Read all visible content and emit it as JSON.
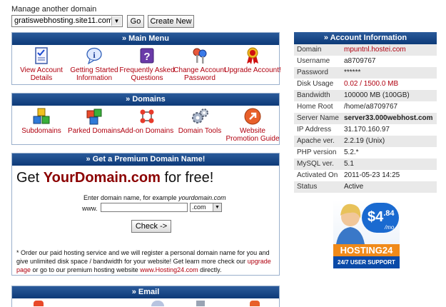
{
  "manage": {
    "label": "Manage another domain",
    "selected_domain": "gratiswebhosting.site11.com",
    "go_label": "Go",
    "create_label": "Create New"
  },
  "main_menu": {
    "title": "» Main Menu",
    "items": [
      {
        "label": "View Account Details",
        "icon": "checklist-icon"
      },
      {
        "label": "Getting Started Information",
        "icon": "info-bubble-icon"
      },
      {
        "label": "Frequently Asked Questions",
        "icon": "question-box-icon"
      },
      {
        "label": "Change Account Password",
        "icon": "keys-icon"
      },
      {
        "label": "Upgrade Account!",
        "icon": "award-ribbon-icon"
      }
    ]
  },
  "domains": {
    "title": "» Domains",
    "items": [
      {
        "label": "Subdomains",
        "icon": "cubes-icon"
      },
      {
        "label": "Parked Domains",
        "icon": "parked-cubes-icon"
      },
      {
        "label": "Add-on Domains",
        "icon": "molecule-icon"
      },
      {
        "label": "Domain Tools",
        "icon": "gears-icon"
      },
      {
        "label": "Website Promotion Guide",
        "icon": "arrow-circle-icon"
      }
    ]
  },
  "premium": {
    "title": "» Get a Premium Domain Name!",
    "headline_pre": "Get ",
    "headline_domain": "YourDomain.com",
    "headline_post": " for free!",
    "instruction": "Enter domain name, for example",
    "instruction_example": "yourdomain.com",
    "www": "www.",
    "tld": ".com",
    "check_label": "Check ->",
    "note_1": "* Order our paid hosting service and we will register a personal domain name for you and give unlimited disk space / bandwidth for your website! Get learn more check our",
    "note_link_1": "upgrade page",
    "note_2": " or go to our premium hosting website ",
    "note_link_2": "www.Hosting24.com",
    "note_3": " directly."
  },
  "email": {
    "title": "» Email"
  },
  "account": {
    "title": "» Account Information",
    "rows": [
      {
        "k": "Domain",
        "v": "mpuntnl.hostei.com"
      },
      {
        "k": "Username",
        "v": "a8709767"
      },
      {
        "k": "Password",
        "v": "******"
      },
      {
        "k": "Disk Usage",
        "v": "0.02 / 1500.0 MB"
      },
      {
        "k": "Bandwidth",
        "v": "100000 MB (100GB)"
      },
      {
        "k": "Home Root",
        "v": "/home/a8709767"
      },
      {
        "k": "Server Name",
        "v": "server33.000webhost.com"
      },
      {
        "k": "IP Address",
        "v": "31.170.160.97"
      },
      {
        "k": "Apache ver.",
        "v": "2.2.19 (Unix)"
      },
      {
        "k": "PHP version",
        "v": "5.2.*"
      },
      {
        "k": "MySQL ver.",
        "v": "5.1"
      },
      {
        "k": "Activated On",
        "v": "2011-05-23 14:25"
      },
      {
        "k": "Status",
        "v": "Active"
      }
    ]
  },
  "ad": {
    "price": "$4",
    "cents": ".84",
    "per": "/mo",
    "brand": "HOSTING24",
    "support": "24/7 USER SUPPORT"
  }
}
